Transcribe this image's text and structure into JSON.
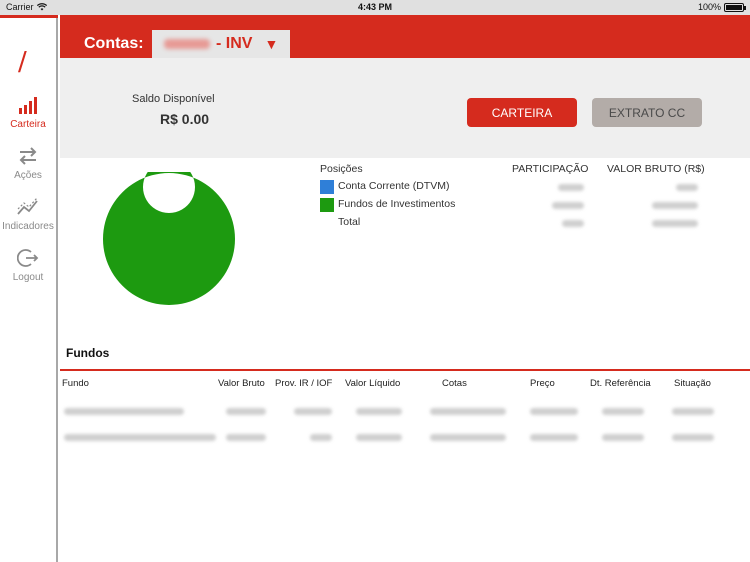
{
  "status_bar": {
    "carrier": "Carrier",
    "time": "4:43 PM",
    "battery": "100%"
  },
  "sidebar": {
    "logo": "/",
    "items": [
      {
        "label": "Carteira",
        "icon": "bar-chart-icon",
        "active": true
      },
      {
        "label": "Ações",
        "icon": "transfer-arrows-icon",
        "active": false
      },
      {
        "label": "Indicadores",
        "icon": "trend-line-icon",
        "active": false
      },
      {
        "label": "Logout",
        "icon": "logout-icon",
        "active": false
      }
    ]
  },
  "header": {
    "contas_label": "Contas:",
    "account_suffix": "- INV",
    "caret": "▼"
  },
  "saldo": {
    "label": "Saldo Disponível",
    "value": "R$ 0.00"
  },
  "buttons": {
    "carteira": "CARTEIRA",
    "extrato": "EXTRATO CC"
  },
  "posicoes": {
    "headers": {
      "posicoes": "Posições",
      "participacao": "PARTICIPAÇÃO",
      "valor_bruto": "VALOR BRUTO (R$)"
    },
    "rows": [
      {
        "label": "Conta Corrente (DTVM)",
        "color": "#2f7fd8"
      },
      {
        "label": "Fundos de Investimentos",
        "color": "#1d9a10"
      },
      {
        "label": "Total",
        "color": ""
      }
    ]
  },
  "chart_data": {
    "type": "pie",
    "donut": true,
    "categories": [
      "Conta Corrente (DTVM)",
      "Fundos de Investimentos"
    ],
    "values": [
      0,
      100
    ],
    "colors": [
      "#2f7fd8",
      "#1d9a10"
    ]
  },
  "fundos": {
    "title": "Fundos",
    "columns": [
      "Fundo",
      "Valor Bruto",
      "Prov. IR / IOF",
      "Valor Líquido",
      "Cotas",
      "Preço",
      "Dt. Referência",
      "Situação"
    ]
  },
  "colors": {
    "brand": "#d52b1e",
    "panel": "#efefef"
  }
}
